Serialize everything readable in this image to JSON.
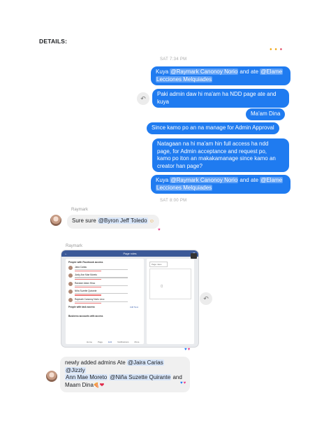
{
  "document": {
    "heading": "DETAILS:"
  },
  "top_reactions": {
    "first": "● ●",
    "second": "●"
  },
  "chat": {
    "timestamps": {
      "first": "SAT 7:34 PM",
      "second": "SAT 8:00 PM"
    },
    "outgoing": [
      {
        "pre": "Kuya ",
        "m1": "@Raymark Canonoy Norio",
        "mid": " and ate ",
        "m2": "@Elame",
        "br": "",
        "m3": "Lecciones Melquiades"
      },
      {
        "l1": "Paki admin daw hi ma'am ha NDD page ate and",
        "l2": "kuya"
      },
      {
        "text": "Ma'am Dina"
      },
      {
        "text": "Since kamo po an na manage for Admin Approval"
      },
      {
        "l1": "Natagaan na hi ma'am hin full access ha ndd",
        "l2": "page, for Admin acceptance and request po,",
        "l3": "kamo po iton an makakamanage since kamo an",
        "l4": "creator han page?"
      },
      {
        "pre": "Kuya ",
        "m1": "@Raymark Canonoy Norio",
        "mid": " and ate ",
        "m2": "@Elame",
        "m3": "Lecciones Melquiades"
      }
    ],
    "incoming": {
      "sender1": "Raymark",
      "msg1_pre": "Sure sure ",
      "msg1_mention": "@Byron Jeff Toledo",
      "msg1_emoji": "☺",
      "heart1": "♥",
      "sender2": "Raymark",
      "msg2": {
        "l1_pre": "newly added admins Ate ",
        "m1": "@Jaira Carias",
        "l1_mid": " ",
        "m2": "@Jizzly",
        "m3": "Ann Mae Moreto",
        "l2_mid": " ",
        "m4": "@Niña Suzette Quirante",
        "l2_post": " and",
        "l3": "Maam Dina",
        "emoji": "🍕",
        "heart": "❤"
      },
      "reactions1": {
        "blue": "♥",
        "pink": "♥"
      },
      "reactions2": {
        "blue": "♥",
        "pink": "♥"
      }
    },
    "share_icon": "↶"
  },
  "screenshot": {
    "title": "Page roles",
    "back": "←",
    "close": "✕",
    "panel_header": "People with Facebook access",
    "people": [
      "Jaira Carias",
      "Jizzly Ann Mae Moreto",
      "Random Aldon Hiroc",
      "Niña Suzette Quirante",
      "Raymark Canonoy Norio Lecc"
    ],
    "task_header": "People with task access",
    "task_link": "Add New",
    "business_header": "Business accounts with access",
    "tabs": [
      "Home",
      "Page",
      "Edit",
      "Notifications",
      "More"
    ],
    "side_select": "Page roles",
    "side_icon": "◻"
  }
}
